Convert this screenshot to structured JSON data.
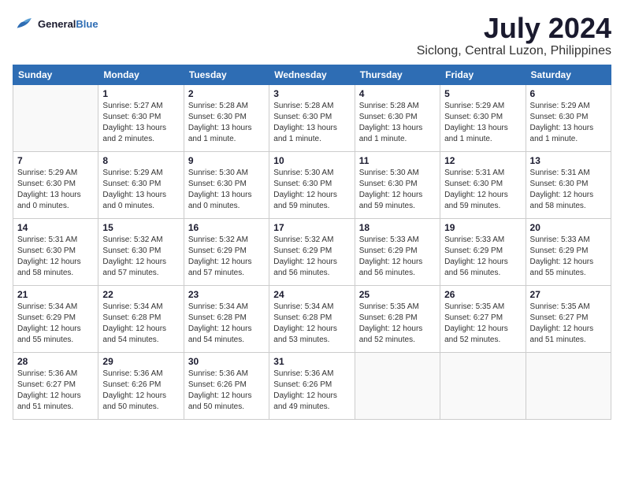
{
  "header": {
    "logo_line1": "General",
    "logo_line2": "Blue",
    "main_title": "July 2024",
    "subtitle": "Siclong, Central Luzon, Philippines"
  },
  "days_of_week": [
    "Sunday",
    "Monday",
    "Tuesday",
    "Wednesday",
    "Thursday",
    "Friday",
    "Saturday"
  ],
  "weeks": [
    [
      {
        "day": "",
        "info": ""
      },
      {
        "day": "1",
        "info": "Sunrise: 5:27 AM\nSunset: 6:30 PM\nDaylight: 13 hours\nand 2 minutes."
      },
      {
        "day": "2",
        "info": "Sunrise: 5:28 AM\nSunset: 6:30 PM\nDaylight: 13 hours\nand 1 minute."
      },
      {
        "day": "3",
        "info": "Sunrise: 5:28 AM\nSunset: 6:30 PM\nDaylight: 13 hours\nand 1 minute."
      },
      {
        "day": "4",
        "info": "Sunrise: 5:28 AM\nSunset: 6:30 PM\nDaylight: 13 hours\nand 1 minute."
      },
      {
        "day": "5",
        "info": "Sunrise: 5:29 AM\nSunset: 6:30 PM\nDaylight: 13 hours\nand 1 minute."
      },
      {
        "day": "6",
        "info": "Sunrise: 5:29 AM\nSunset: 6:30 PM\nDaylight: 13 hours\nand 1 minute."
      }
    ],
    [
      {
        "day": "7",
        "info": "Sunrise: 5:29 AM\nSunset: 6:30 PM\nDaylight: 13 hours\nand 0 minutes."
      },
      {
        "day": "8",
        "info": "Sunrise: 5:29 AM\nSunset: 6:30 PM\nDaylight: 13 hours\nand 0 minutes."
      },
      {
        "day": "9",
        "info": "Sunrise: 5:30 AM\nSunset: 6:30 PM\nDaylight: 13 hours\nand 0 minutes."
      },
      {
        "day": "10",
        "info": "Sunrise: 5:30 AM\nSunset: 6:30 PM\nDaylight: 12 hours\nand 59 minutes."
      },
      {
        "day": "11",
        "info": "Sunrise: 5:30 AM\nSunset: 6:30 PM\nDaylight: 12 hours\nand 59 minutes."
      },
      {
        "day": "12",
        "info": "Sunrise: 5:31 AM\nSunset: 6:30 PM\nDaylight: 12 hours\nand 59 minutes."
      },
      {
        "day": "13",
        "info": "Sunrise: 5:31 AM\nSunset: 6:30 PM\nDaylight: 12 hours\nand 58 minutes."
      }
    ],
    [
      {
        "day": "14",
        "info": "Sunrise: 5:31 AM\nSunset: 6:30 PM\nDaylight: 12 hours\nand 58 minutes."
      },
      {
        "day": "15",
        "info": "Sunrise: 5:32 AM\nSunset: 6:30 PM\nDaylight: 12 hours\nand 57 minutes."
      },
      {
        "day": "16",
        "info": "Sunrise: 5:32 AM\nSunset: 6:29 PM\nDaylight: 12 hours\nand 57 minutes."
      },
      {
        "day": "17",
        "info": "Sunrise: 5:32 AM\nSunset: 6:29 PM\nDaylight: 12 hours\nand 56 minutes."
      },
      {
        "day": "18",
        "info": "Sunrise: 5:33 AM\nSunset: 6:29 PM\nDaylight: 12 hours\nand 56 minutes."
      },
      {
        "day": "19",
        "info": "Sunrise: 5:33 AM\nSunset: 6:29 PM\nDaylight: 12 hours\nand 56 minutes."
      },
      {
        "day": "20",
        "info": "Sunrise: 5:33 AM\nSunset: 6:29 PM\nDaylight: 12 hours\nand 55 minutes."
      }
    ],
    [
      {
        "day": "21",
        "info": "Sunrise: 5:34 AM\nSunset: 6:29 PM\nDaylight: 12 hours\nand 55 minutes."
      },
      {
        "day": "22",
        "info": "Sunrise: 5:34 AM\nSunset: 6:28 PM\nDaylight: 12 hours\nand 54 minutes."
      },
      {
        "day": "23",
        "info": "Sunrise: 5:34 AM\nSunset: 6:28 PM\nDaylight: 12 hours\nand 54 minutes."
      },
      {
        "day": "24",
        "info": "Sunrise: 5:34 AM\nSunset: 6:28 PM\nDaylight: 12 hours\nand 53 minutes."
      },
      {
        "day": "25",
        "info": "Sunrise: 5:35 AM\nSunset: 6:28 PM\nDaylight: 12 hours\nand 52 minutes."
      },
      {
        "day": "26",
        "info": "Sunrise: 5:35 AM\nSunset: 6:27 PM\nDaylight: 12 hours\nand 52 minutes."
      },
      {
        "day": "27",
        "info": "Sunrise: 5:35 AM\nSunset: 6:27 PM\nDaylight: 12 hours\nand 51 minutes."
      }
    ],
    [
      {
        "day": "28",
        "info": "Sunrise: 5:36 AM\nSunset: 6:27 PM\nDaylight: 12 hours\nand 51 minutes."
      },
      {
        "day": "29",
        "info": "Sunrise: 5:36 AM\nSunset: 6:26 PM\nDaylight: 12 hours\nand 50 minutes."
      },
      {
        "day": "30",
        "info": "Sunrise: 5:36 AM\nSunset: 6:26 PM\nDaylight: 12 hours\nand 50 minutes."
      },
      {
        "day": "31",
        "info": "Sunrise: 5:36 AM\nSunset: 6:26 PM\nDaylight: 12 hours\nand 49 minutes."
      },
      {
        "day": "",
        "info": ""
      },
      {
        "day": "",
        "info": ""
      },
      {
        "day": "",
        "info": ""
      }
    ]
  ]
}
